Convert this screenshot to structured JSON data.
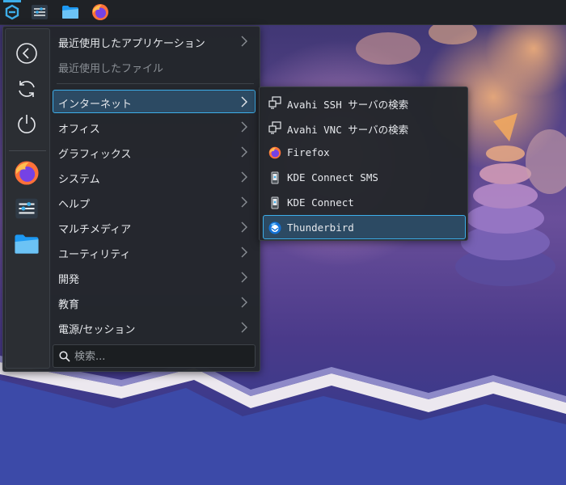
{
  "menu": {
    "categories": [
      {
        "label": "最近使用したアプリケーション"
      },
      {
        "label": "最近使用したファイル"
      },
      {
        "label": "インターネット"
      },
      {
        "label": "オフィス"
      },
      {
        "label": "グラフィックス"
      },
      {
        "label": "システム"
      },
      {
        "label": "ヘルプ"
      },
      {
        "label": "マルチメディア"
      },
      {
        "label": "ユーティリティ"
      },
      {
        "label": "開発"
      },
      {
        "label": "教育"
      },
      {
        "label": "電源/セッション"
      }
    ],
    "search": {
      "placeholder": "検索..."
    }
  },
  "submenu": {
    "items": [
      {
        "label": "Avahi SSH サーバの検索",
        "icon": "network-icon"
      },
      {
        "label": "Avahi VNC サーバの検索",
        "icon": "network-icon"
      },
      {
        "label": "Firefox",
        "icon": "firefox-icon"
      },
      {
        "label": "KDE Connect SMS",
        "icon": "kdeconnect-icon"
      },
      {
        "label": "KDE Connect",
        "icon": "kdeconnect-icon"
      },
      {
        "label": "Thunderbird",
        "icon": "thunderbird-icon"
      }
    ]
  },
  "colors": {
    "accent": "#3daee9",
    "highlight": "#2c4a63",
    "menu_bg": "#23262a",
    "panel_bg": "#1f2226"
  }
}
